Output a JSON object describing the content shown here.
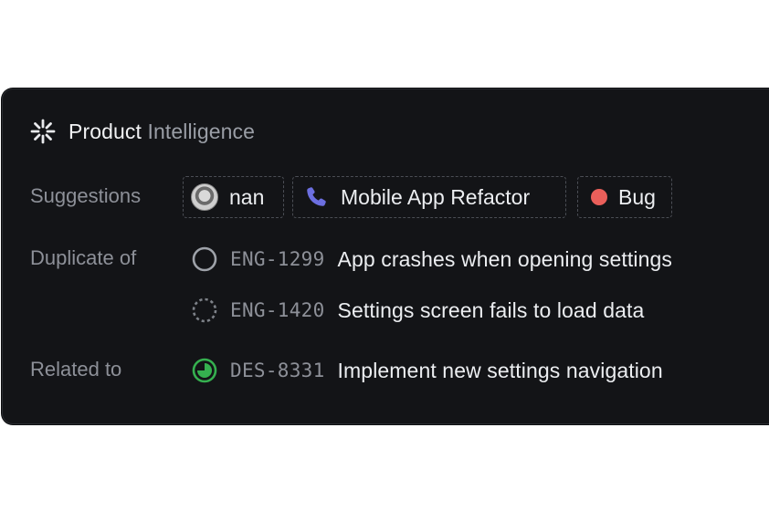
{
  "header": {
    "title_prefix": "Product ",
    "title_suffix": "Intelligence",
    "icon": "sparkle-icon"
  },
  "suggestions": {
    "label": "Suggestions",
    "chips": [
      {
        "type": "user",
        "label": "nan",
        "icon": "avatar"
      },
      {
        "type": "project",
        "label": "Mobile App Refactor",
        "icon": "phone-icon"
      },
      {
        "type": "label",
        "label": "Bug",
        "icon": "red-dot-icon",
        "color": "#ea5f5a"
      }
    ]
  },
  "duplicate_of": {
    "label": "Duplicate of",
    "issues": [
      {
        "id": "ENG-1299",
        "title": "App crashes when opening settings",
        "status": "todo"
      },
      {
        "id": "ENG-1420",
        "title": "Settings screen fails to load data",
        "status": "backlog"
      }
    ]
  },
  "related_to": {
    "label": "Related to",
    "issues": [
      {
        "id": "DES-8331",
        "title": "Implement new settings navigation",
        "status": "in-progress",
        "color": "#35b04f"
      }
    ]
  }
}
